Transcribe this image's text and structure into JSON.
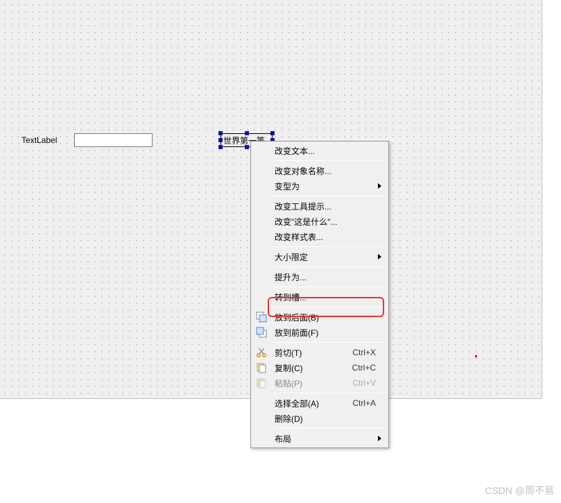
{
  "canvas": {
    "textLabel": "TextLabel",
    "selectedButton": "世界第一等"
  },
  "menu": {
    "changeText": "改变文本...",
    "changeObjectName": "改变对象名称...",
    "morphInto": "变型为",
    "changeToolTip": "改变工具提示...",
    "changeWhatsThis": "改变\"这是什么\"...",
    "changeStyleSheet": "改变样式表...",
    "sizeConstraints": "大小限定",
    "promoteTo": "提升为...",
    "goToSlot": "转到槽...",
    "sendToBack": "放到后面(B)",
    "bringToFront": "放到前面(F)",
    "cut": "剪切(T)",
    "cutKey": "Ctrl+X",
    "copy": "复制(C)",
    "copyKey": "Ctrl+C",
    "paste": "粘贴(P)",
    "pasteKey": "Ctrl+V",
    "selectAll": "选择全部(A)",
    "selectAllKey": "Ctrl+A",
    "delete": "删除(D)",
    "layout": "布局"
  },
  "watermark": "CSDN @周不易"
}
